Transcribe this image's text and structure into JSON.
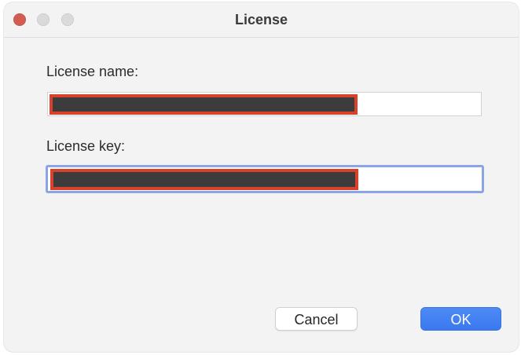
{
  "window": {
    "title": "License"
  },
  "form": {
    "license_name_label": "License name:",
    "license_key_label": "License key:",
    "license_name_value": "",
    "license_key_value": ""
  },
  "buttons": {
    "cancel_label": "Cancel",
    "ok_label": "OK"
  },
  "colors": {
    "accent": "#3b7bf0",
    "focus_ring": "#8aa4ea",
    "close_button": "#d35c51",
    "redaction_border": "#d9412b",
    "redaction_fill": "#3c3c3c"
  }
}
